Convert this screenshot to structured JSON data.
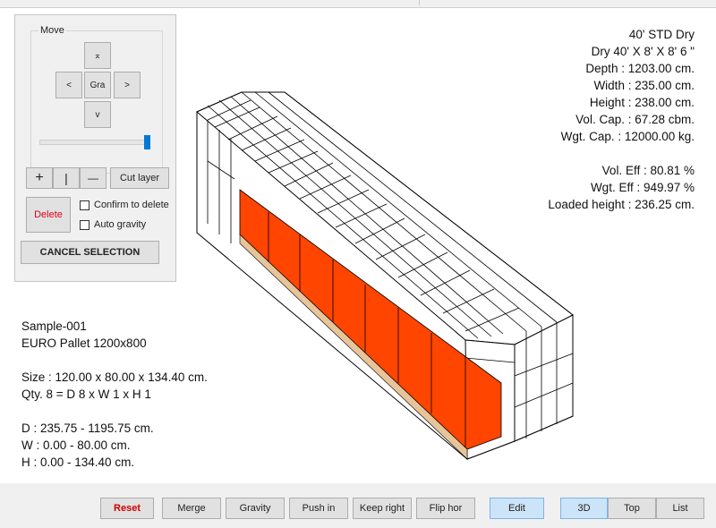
{
  "move_panel": {
    "group_label": "Move",
    "up_label": "⌅",
    "left_label": "<",
    "center_label": "Gra",
    "right_label": ">",
    "down_label": "v",
    "slider_value": 1.0,
    "plus_label": "+",
    "mid_label": "|",
    "minus_label": "—",
    "cut_layer_label": "Cut layer",
    "delete_label": "Delete",
    "confirm_delete_label": "Confirm to delete",
    "auto_gravity_label": "Auto gravity",
    "cancel_selection_label": "CANCEL SELECTION"
  },
  "container_info": [
    "40' STD Dry",
    "Dry 40' X 8' X 8' 6 \"",
    "Depth : 1203.00 cm.",
    "Width : 235.00 cm.",
    "Height : 238.00 cm.",
    "Vol. Cap. : 67.28 cbm.",
    "Wgt. Cap. : 12000.00 kg."
  ],
  "efficiency_info": [
    "Vol. Eff : 80.81 %",
    "Wgt. Eff : 949.97 %",
    "Loaded height : 236.25 cm."
  ],
  "item_info": {
    "name": "Sample-001",
    "type": "EURO Pallet 1200x800",
    "size": "Size : 120.00 x 80.00 x 134.40 cm.",
    "qty": "Qty. 8 = D 8 x W 1 x H 1",
    "d": "D : 235.75 - 1195.75 cm.",
    "w": "W : 0.00 - 80.00 cm.",
    "h": "H : 0.00 - 134.40 cm."
  },
  "toolbar": {
    "reset": "Reset",
    "merge": "Merge",
    "gravity": "Gravity",
    "push_in": "Push in",
    "keep_right": "Keep right",
    "flip_hor": "Flip hor",
    "edit": "Edit",
    "view_3d": "3D",
    "view_top": "Top",
    "view_list": "List"
  },
  "colors": {
    "selected_cargo": "#ff4500",
    "pallet": "#e7c49a",
    "reset_text": "#d00000",
    "delete_text": "#e0001a",
    "active_button": "#cce4f7"
  }
}
